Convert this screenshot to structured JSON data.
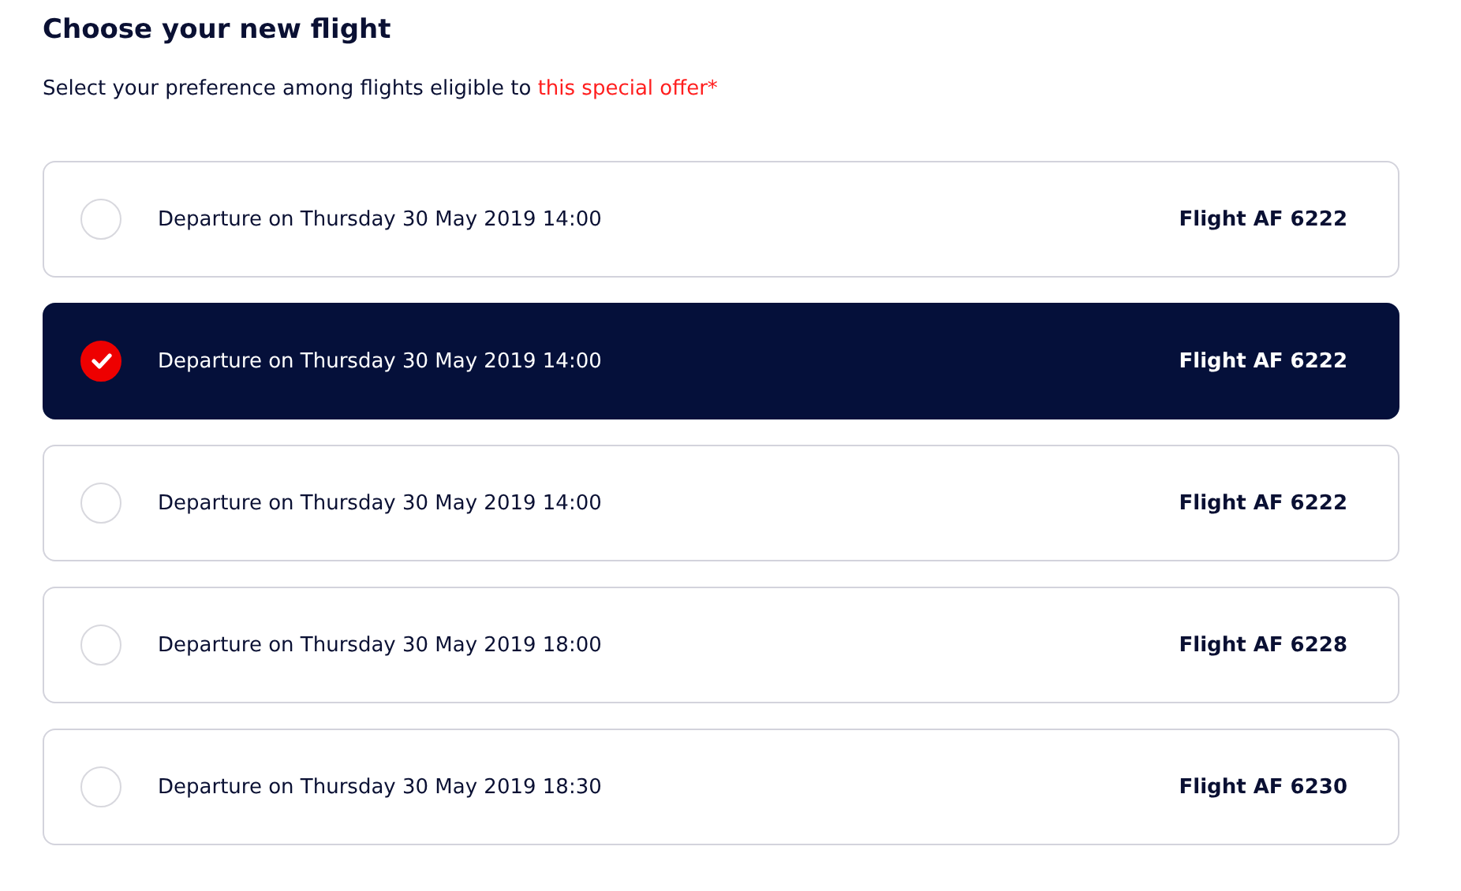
{
  "heading": "Choose your new flight",
  "intro": {
    "text": "Select your preference among flights eligible to ",
    "link": "this special offer*"
  },
  "flights": [
    {
      "departure": "Departure on Thursday 30 May 2019 14:00",
      "flight": "Flight AF 6222",
      "selected": false
    },
    {
      "departure": "Departure on Thursday 30 May 2019 14:00",
      "flight": "Flight AF 6222",
      "selected": true
    },
    {
      "departure": "Departure on Thursday 30 May 2019 14:00",
      "flight": "Flight AF 6222",
      "selected": false
    },
    {
      "departure": "Departure on Thursday 30 May 2019 18:00",
      "flight": "Flight AF 6228",
      "selected": false
    },
    {
      "departure": "Departure on Thursday 30 May 2019 18:30",
      "flight": "Flight AF 6230",
      "selected": false
    }
  ]
}
